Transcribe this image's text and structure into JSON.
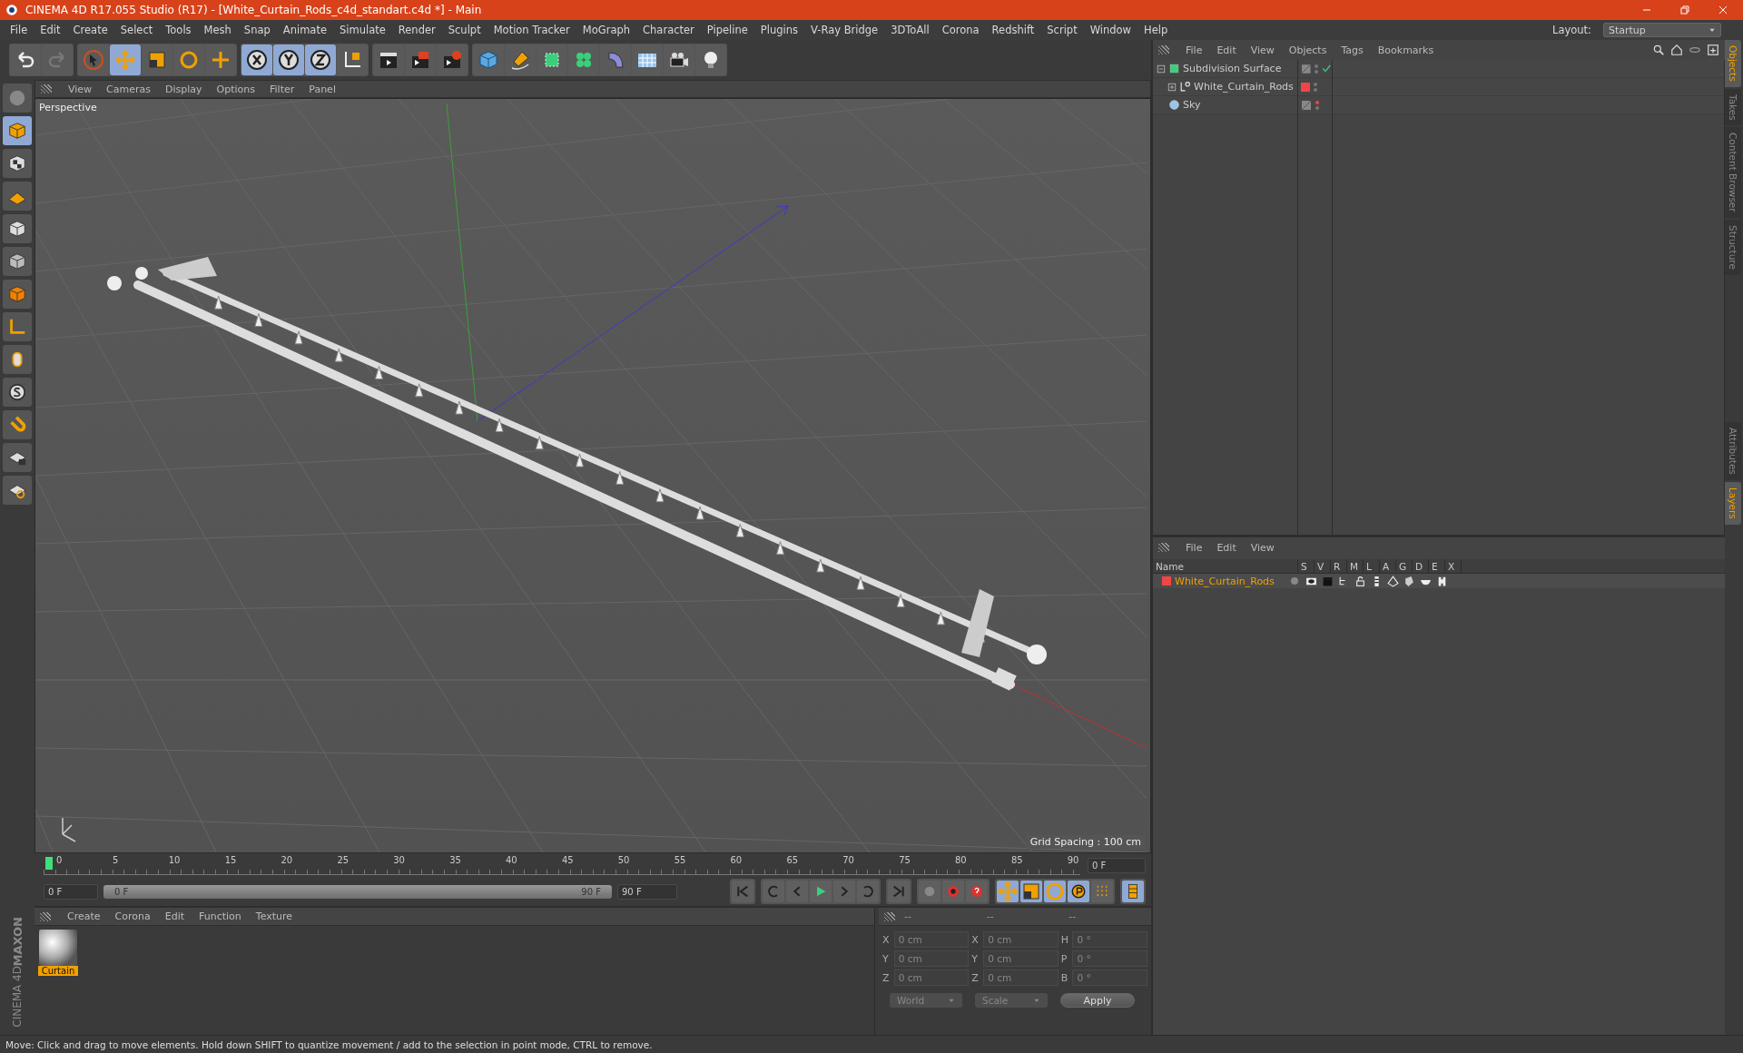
{
  "window": {
    "title": "CINEMA 4D R17.055 Studio (R17) - [White_Curtain_Rods_c4d_standart.c4d *] - Main"
  },
  "menu": [
    "File",
    "Edit",
    "Create",
    "Select",
    "Tools",
    "Mesh",
    "Snap",
    "Animate",
    "Simulate",
    "Render",
    "Sculpt",
    "Motion Tracker",
    "MoGraph",
    "Character",
    "Pipeline",
    "Plugins",
    "V-Ray Bridge",
    "3DToAll",
    "Corona",
    "Redshift",
    "Script",
    "Window",
    "Help"
  ],
  "layout": {
    "label": "Layout:",
    "value": "Startup"
  },
  "toolbar_groups": [
    {
      "buttons": [
        {
          "kind": "undo",
          "selected": false
        },
        {
          "kind": "redo",
          "selected": false
        }
      ]
    },
    {
      "buttons": [
        {
          "kind": "select",
          "selected": false
        },
        {
          "kind": "move",
          "selected": true
        },
        {
          "kind": "scale",
          "selected": false
        },
        {
          "kind": "rotate",
          "selected": false
        },
        {
          "kind": "transform",
          "selected": false
        }
      ]
    },
    {
      "buttons": [
        {
          "kind": "x",
          "selected": true
        },
        {
          "kind": "y",
          "selected": true
        },
        {
          "kind": "z",
          "selected": true
        },
        {
          "kind": "coord",
          "selected": false
        }
      ]
    },
    {
      "buttons": [
        {
          "kind": "render-view",
          "selected": false
        },
        {
          "kind": "render",
          "selected": false
        },
        {
          "kind": "render-settings",
          "selected": false
        }
      ]
    },
    {
      "buttons": [
        {
          "kind": "cube",
          "selected": false
        },
        {
          "kind": "pen",
          "selected": false
        },
        {
          "kind": "subdiv",
          "selected": false
        },
        {
          "kind": "cloner",
          "selected": false
        },
        {
          "kind": "deformer",
          "selected": false
        },
        {
          "kind": "floor",
          "selected": false
        },
        {
          "kind": "camera",
          "selected": false
        },
        {
          "kind": "light",
          "selected": false
        }
      ]
    }
  ],
  "left_toolbar": [
    {
      "kind": "editable",
      "selected": false
    },
    {
      "kind": "model",
      "selected": true
    },
    {
      "kind": "texture",
      "selected": false
    },
    {
      "kind": "workplane",
      "selected": false
    },
    {
      "kind": "points",
      "selected": false
    },
    {
      "kind": "edges",
      "selected": false
    },
    {
      "kind": "polygons",
      "selected": false
    },
    {
      "kind": "axis",
      "selected": false
    },
    {
      "kind": "tweak",
      "selected": false
    },
    {
      "kind": "snap",
      "selected": false
    },
    {
      "kind": "magnet",
      "selected": false
    },
    {
      "kind": "lock",
      "selected": false
    },
    {
      "kind": "gridcycle",
      "selected": false
    }
  ],
  "viewport": {
    "menu": [
      "View",
      "Cameras",
      "Display",
      "Options",
      "Filter",
      "Panel"
    ],
    "label": "Perspective",
    "grid_spacing": "Grid Spacing : 100 cm"
  },
  "timeline": {
    "ticks": [
      "0",
      "5",
      "10",
      "15",
      "20",
      "25",
      "30",
      "35",
      "40",
      "45",
      "50",
      "55",
      "60",
      "65",
      "70",
      "75",
      "80",
      "85",
      "90"
    ],
    "current": "0 F",
    "start": "0 F",
    "range": {
      "start": "0 F",
      "end": "90 F",
      "level": 1
    },
    "end": "90 F"
  },
  "materials": {
    "menu": [
      "Create",
      "Corona",
      "Edit",
      "Function",
      "Texture"
    ],
    "items": [
      {
        "name": "Curtain",
        "selected": true
      }
    ]
  },
  "coordinates": {
    "headers": [
      "--",
      "--",
      "--"
    ],
    "rows": [
      {
        "a": "X",
        "av": "0 cm",
        "b": "X",
        "bv": "0 cm",
        "c": "H",
        "cv": "0 °"
      },
      {
        "a": "Y",
        "av": "0 cm",
        "b": "Y",
        "bv": "0 cm",
        "c": "P",
        "cv": "0 °"
      },
      {
        "a": "Z",
        "av": "0 cm",
        "b": "Z",
        "bv": "0 cm",
        "c": "B",
        "cv": "0 °"
      }
    ],
    "mode": "World",
    "scale": "Scale",
    "apply": "Apply"
  },
  "logo": {
    "brand": "MAXON",
    "product": "CINEMA 4D"
  },
  "status": "Move: Click and drag to move elements. Hold down SHIFT to quantize movement / add to the selection in point mode, CTRL to remove.",
  "objects": {
    "menu": [
      "File",
      "Edit",
      "View",
      "Objects",
      "Tags",
      "Bookmarks"
    ],
    "tree": [
      {
        "name": "Subdivision Surface",
        "kind": "subdiv",
        "checked": true,
        "editor_off": false,
        "expanded": true,
        "children": [
          {
            "name": "White_Curtain_Rods",
            "kind": "null",
            "checked": false,
            "editor_off": false,
            "color": "#f04545",
            "expanded": false
          }
        ]
      },
      {
        "name": "Sky",
        "kind": "sky",
        "checked": false,
        "editor_off": true
      }
    ]
  },
  "layers": {
    "menu": [
      "File",
      "Edit",
      "View"
    ],
    "columns": [
      "Name",
      "S",
      "V",
      "R",
      "M",
      "L",
      "A",
      "G",
      "D",
      "E",
      "X"
    ],
    "rows": [
      {
        "name": "White_Curtain_Rods",
        "color": "#f04545"
      }
    ]
  },
  "side_tabs_top": [
    {
      "label": "Objects",
      "selected": true
    },
    {
      "label": "Takes",
      "selected": false
    },
    {
      "label": "Content Browser",
      "selected": false
    },
    {
      "label": "Structure",
      "selected": false
    }
  ],
  "side_tabs_bottom": [
    {
      "label": "Attributes",
      "selected": false
    },
    {
      "label": "Layers",
      "selected": true
    }
  ]
}
